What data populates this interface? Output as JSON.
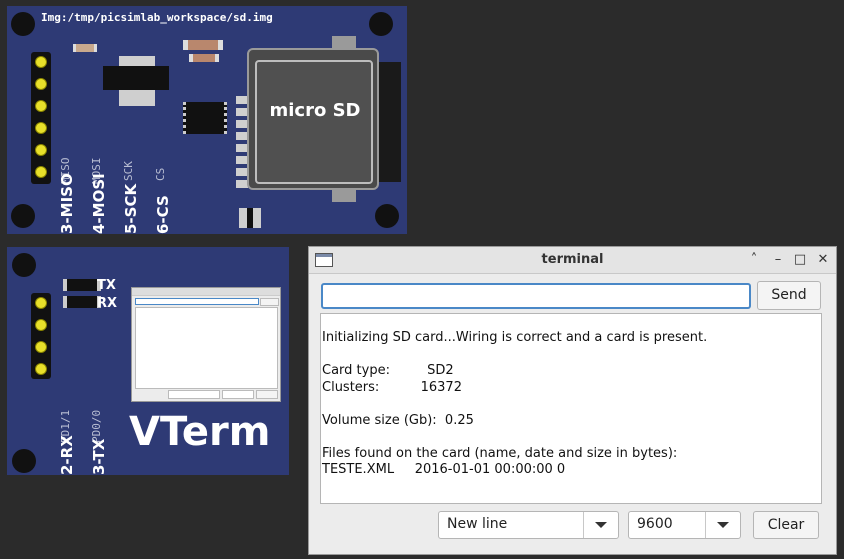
{
  "sd_board": {
    "image_path": "Img:/tmp/picsimlab_workspace/sd.img",
    "logo_text": "micro SD",
    "pin_labels_small": [
      "MISO",
      "MOSI",
      "SCK",
      "CS"
    ],
    "pin_labels_big": [
      "3-MISO",
      "4-MOSI",
      "5-SCK",
      "6-CS"
    ]
  },
  "vterm_board": {
    "tx_label": "TX",
    "rx_label": "RX",
    "pin_labels_small": [
      "PD1/1",
      "PD0/0"
    ],
    "pin_labels_big": [
      "2-RX",
      "3-TX"
    ],
    "title": "VTerm"
  },
  "terminal": {
    "title": "terminal",
    "input_value": "",
    "send_label": "Send",
    "output_lines": [
      "Initializing SD card...Wiring is correct and a card is present.",
      "",
      "Card type:         SD2",
      "Clusters:          16372",
      "",
      "Volume size (Gb):  0.25",
      "",
      "Files found on the card (name, date and size in bytes): ",
      "TESTE.XML     2016-01-01 00:00:00 0"
    ],
    "line_ending": "New line",
    "baud_rate": "9600",
    "clear_label": "Clear"
  }
}
